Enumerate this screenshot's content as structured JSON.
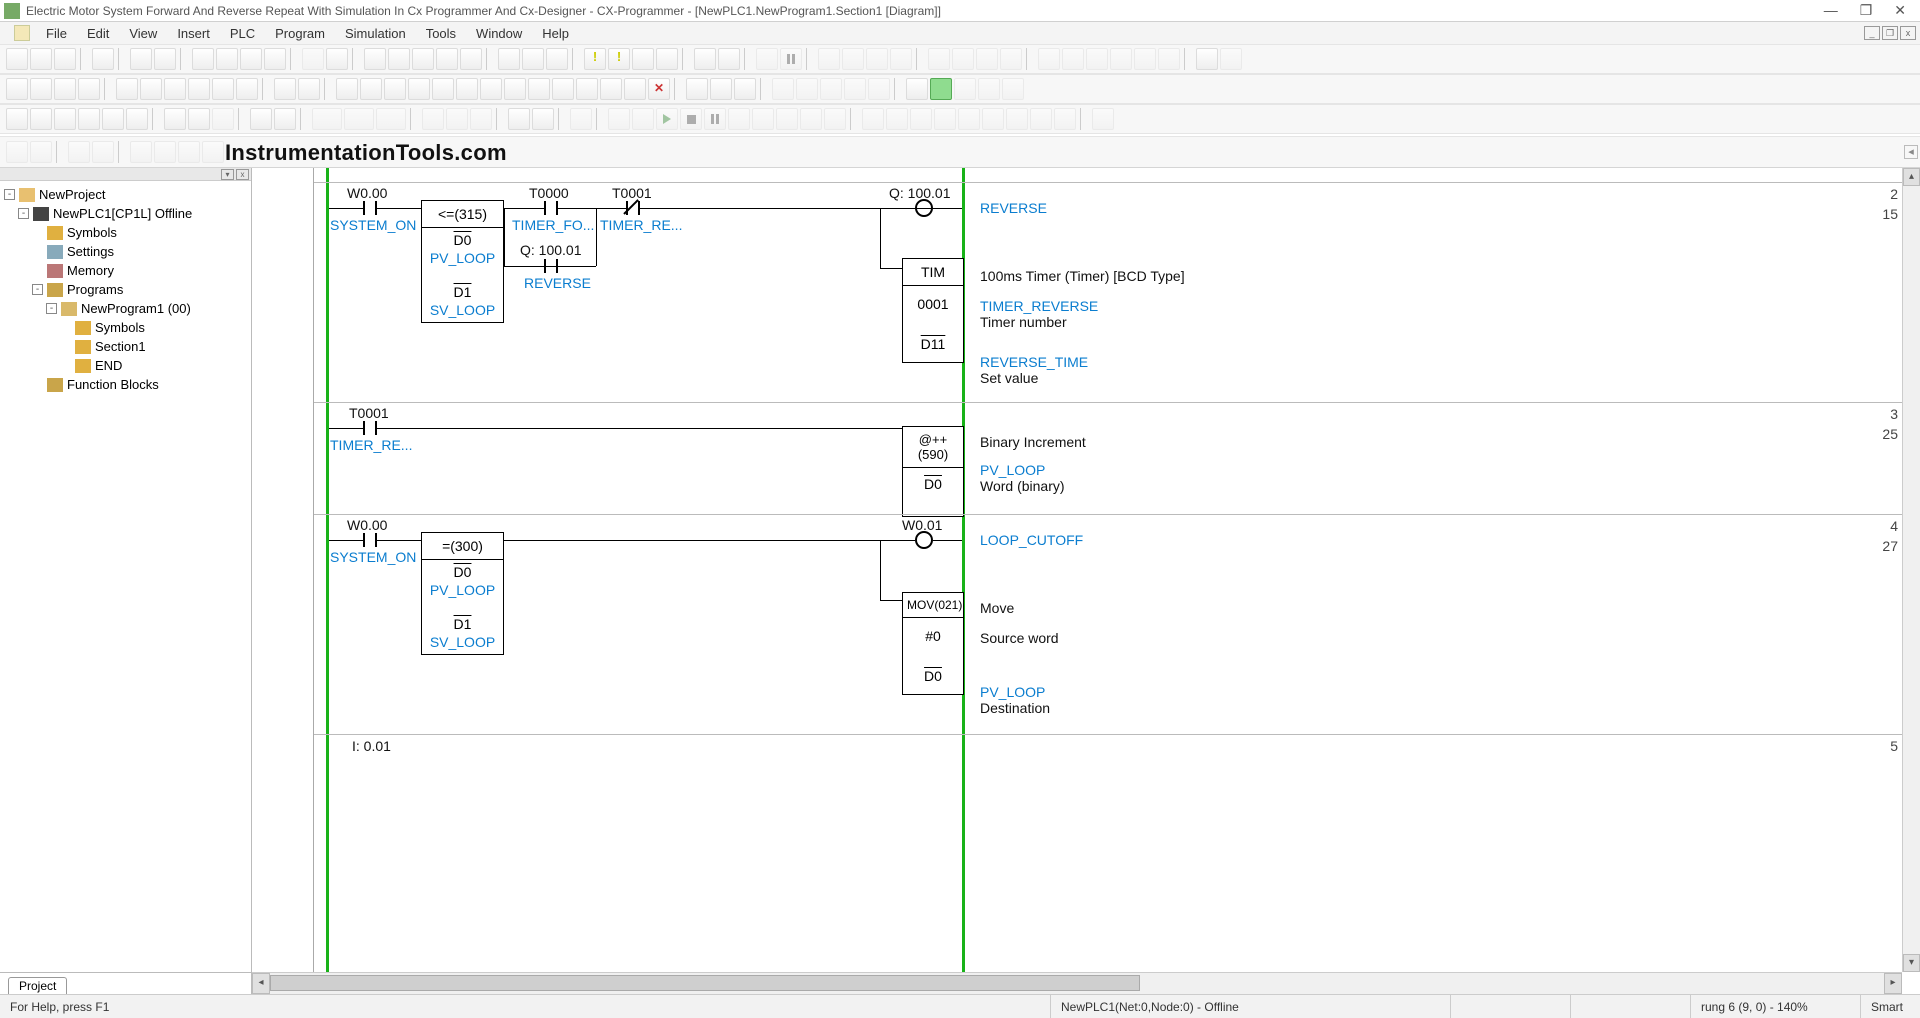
{
  "title": "Electric Motor System Forward And Reverse Repeat With Simulation In Cx Programmer And Cx-Designer - CX-Programmer - [NewPLC1.NewProgram1.Section1 [Diagram]]",
  "menu": {
    "file": "File",
    "edit": "Edit",
    "view": "View",
    "insert": "Insert",
    "plc": "PLC",
    "program": "Program",
    "simulation": "Simulation",
    "tools": "Tools",
    "window": "Window",
    "help": "Help"
  },
  "watermark": "InstrumentationTools.com",
  "project_tab": "Project",
  "tree": {
    "root": "NewProject",
    "plc": "NewPLC1[CP1L] Offline",
    "symbols": "Symbols",
    "settings": "Settings",
    "memory": "Memory",
    "programs": "Programs",
    "newprogram": "NewProgram1 (00)",
    "p_symbols": "Symbols",
    "section1": "Section1",
    "end": "END",
    "fblocks": "Function Blocks"
  },
  "rungs": {
    "r2": {
      "num": "2",
      "step": "15",
      "w000": "W0.00",
      "system_on": "SYSTEM_ON",
      "cmp": "<=(315)",
      "d0": "D0",
      "pv": "PV_LOOP",
      "d1": "D1",
      "sv": "SV_LOOP",
      "t0000": "T0000",
      "timer_fo": "TIMER_FO...",
      "t0001": "T0001",
      "timer_re": "TIMER_RE...",
      "q10001": "Q: 100.01",
      "reverse": "REVERSE",
      "tim": "TIM",
      "tnum": "0001",
      "d11": "D11",
      "c_timer": "100ms Timer (Timer) [BCD Type]",
      "c_trev": "TIMER_REVERSE",
      "c_tnum": "Timer number",
      "c_revtime": "REVERSE_TIME",
      "c_setv": "Set value"
    },
    "r3": {
      "num": "3",
      "step": "25",
      "t0001": "T0001",
      "timer_re": "TIMER_RE...",
      "inc": "@++(590)",
      "d0": "D0",
      "c_binc": "Binary Increment",
      "c_pv": "PV_LOOP",
      "c_word": "Word (binary)"
    },
    "r4": {
      "num": "4",
      "step": "27",
      "w000": "W0.00",
      "system_on": "SYSTEM_ON",
      "eq": "=(300)",
      "d0": "D0",
      "pv": "PV_LOOP",
      "d1": "D1",
      "sv": "SV_LOOP",
      "w001": "W0.01",
      "loop": "LOOP_CUTOFF",
      "mov": "MOV(021)",
      "src": "#0",
      "dst": "D0",
      "c_move": "Move",
      "c_src": "Source word",
      "c_pv": "PV_LOOP",
      "c_dst": "Destination"
    },
    "r5": {
      "num": "5",
      "i001": "I: 0.01"
    }
  },
  "status": {
    "help": "For Help, press F1",
    "plc": "NewPLC1(Net:0,Node:0) - Offline",
    "rung": "rung 6 (9, 0)  - 140%",
    "smart": "Smart"
  }
}
